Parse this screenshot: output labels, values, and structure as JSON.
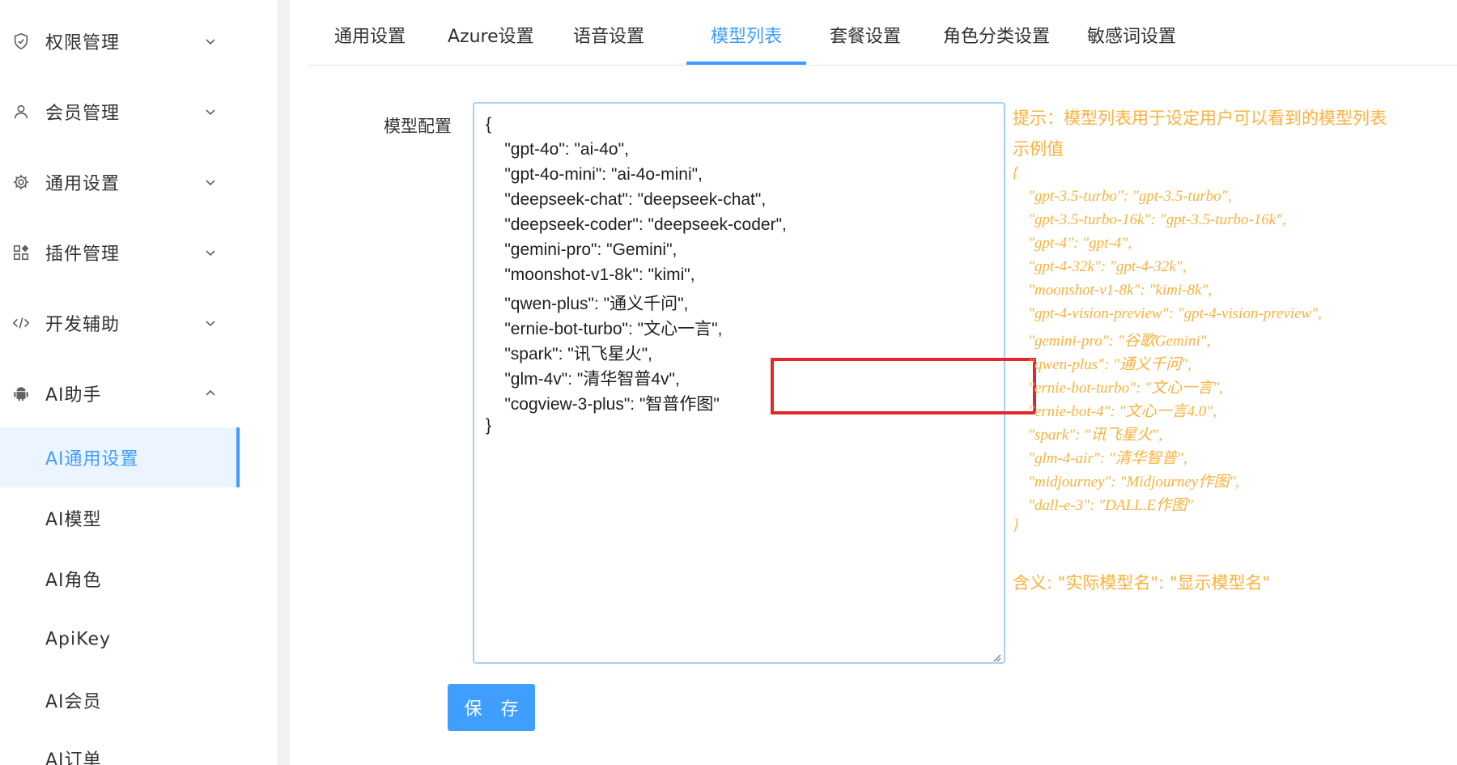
{
  "sidebar": {
    "items": [
      {
        "label": "权限管理",
        "icon": "shield-icon"
      },
      {
        "label": "会员管理",
        "icon": "user-icon"
      },
      {
        "label": "通用设置",
        "icon": "gear-icon"
      },
      {
        "label": "插件管理",
        "icon": "plugin-grid-icon"
      },
      {
        "label": "开发辅助",
        "icon": "code-icon"
      },
      {
        "label": "AI助手",
        "icon": "android-icon",
        "expanded": true
      }
    ],
    "sub_items": [
      {
        "label": "AI通用设置",
        "active": true
      },
      {
        "label": "AI模型"
      },
      {
        "label": "AI角色"
      },
      {
        "label": "ApiKey"
      },
      {
        "label": "AI会员"
      },
      {
        "label": "AI订单"
      }
    ]
  },
  "tabs": [
    {
      "label": "通用设置"
    },
    {
      "label": "Azure设置"
    },
    {
      "label": "语音设置"
    },
    {
      "label": "模型列表",
      "active": true
    },
    {
      "label": "套餐设置"
    },
    {
      "label": "角色分类设置"
    },
    {
      "label": "敏感词设置"
    }
  ],
  "form": {
    "label": "模型配置",
    "textarea_lines": [
      "{",
      "    \"gpt-4o\": \"ai-4o\",",
      "    \"gpt-4o-mini\": \"ai-4o-mini\",",
      "    \"deepseek-chat\": \"deepseek-chat\",",
      "    \"deepseek-coder\": \"deepseek-coder\",",
      "    \"gemini-pro\": \"Gemini\",",
      "    \"moonshot-v1-8k\": \"kimi\",",
      "    \"qwen-plus\": \"通义千问\",",
      "    \"ernie-bot-turbo\": \"文心一言\",",
      "    \"spark\": \"讯飞星火\",",
      "    \"glm-4v\": \"清华智普4v\",",
      "    \"cogview-3-plus\": \"智普作图\"",
      "}"
    ],
    "save_label": "保 存"
  },
  "hint": {
    "title": "提示：模型列表用于设定用户可以看到的模型列表",
    "example_title": "示例值",
    "example_lines": [
      "{",
      "    \"gpt-3.5-turbo\": \"gpt-3.5-turbo\",",
      "    \"gpt-3.5-turbo-16k\": \"gpt-3.5-turbo-16k\",",
      "    \"gpt-4\": \"gpt-4\",",
      "    \"gpt-4-32k\": \"gpt-4-32k\",",
      "    \"moonshot-v1-8k\": \"kimi-8k\",",
      "    \"gpt-4-vision-preview\": \"gpt-4-vision-preview\",",
      "    \"gemini-pro\": \"谷歌Gemini\",",
      "    \"qwen-plus\": \"通义千问\",",
      "    \"ernie-bot-turbo\": \"文心一言\",",
      "    \"ernie-bot-4\": \"文心一言4.0\",",
      "    \"spark\": \"讯飞星火\",",
      "    \"glm-4-air\": \"清华智普\",",
      "    \"midjourney\": \"Midjourney作图\",",
      "    \"dall-e-3\": \"DALL.E作图\"",
      "}"
    ],
    "meaning": "含义: \"实际模型名\": \"显示模型名\""
  },
  "colors": {
    "accent": "#409eff",
    "hint": "#fcb13d",
    "highlight_border": "#e4262b",
    "active_bg": "#ecf5ff"
  }
}
